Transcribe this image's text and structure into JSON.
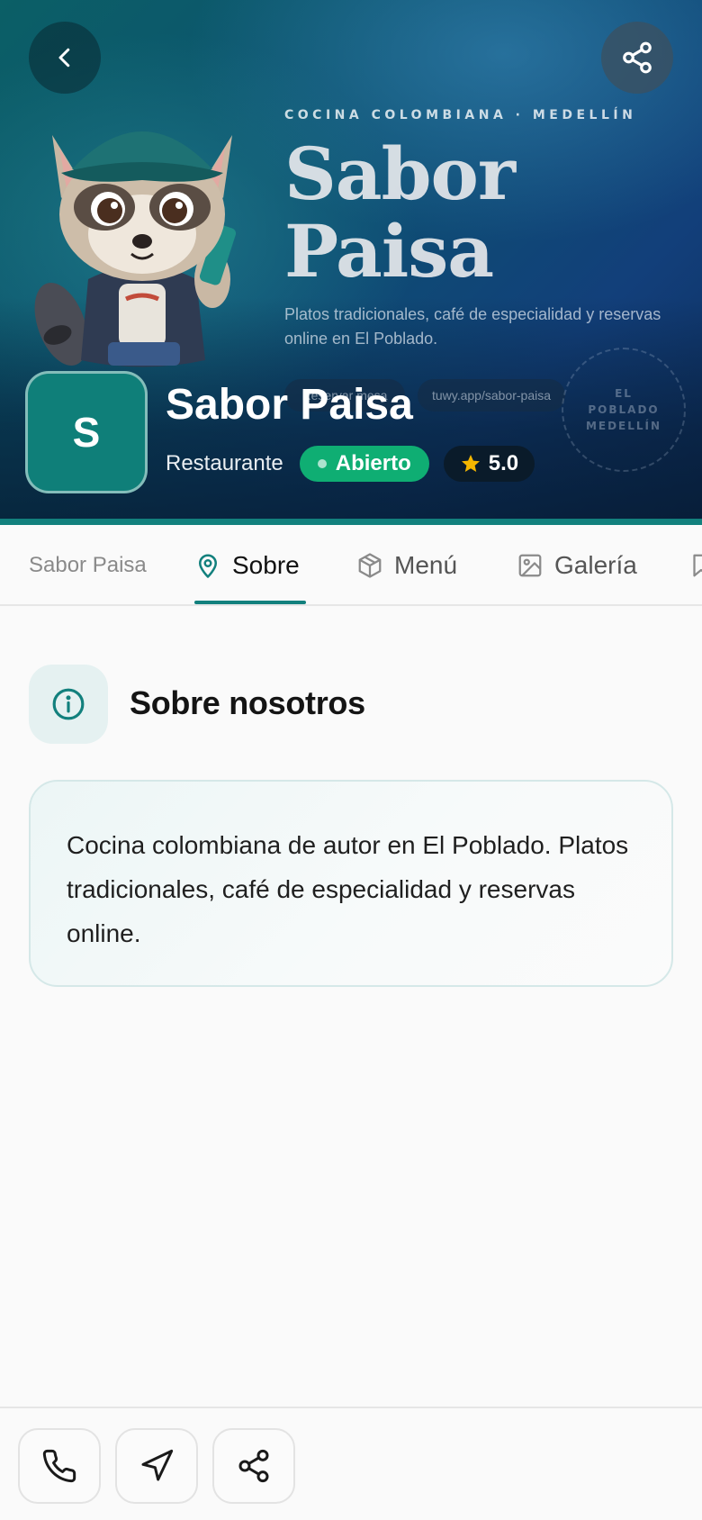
{
  "hero": {
    "kicker": "COCINA COLOMBIANA · MEDELLÍN",
    "title_line1": "Sabor",
    "title_line2": "Paisa",
    "description": "Platos tradicionales, café de especialidad y reservas online en El Poblado.",
    "ghost_pill_1": "Reservar mesa",
    "ghost_pill_2": "tuwy.app/sabor-paisa",
    "stamp_line1": "EL",
    "stamp_line2": "POBLADO",
    "stamp_line3": "MEDELLÍN"
  },
  "business": {
    "avatar_letter": "S",
    "name": "Sabor Paisa",
    "category": "Restaurante",
    "status": "Abierto",
    "rating": "5.0"
  },
  "tabs": [
    {
      "label": "Sabor Paisa",
      "icon": "none",
      "active": false
    },
    {
      "label": "Sobre",
      "icon": "map-pin-icon",
      "active": true
    },
    {
      "label": "Menú",
      "icon": "box-icon",
      "active": false
    },
    {
      "label": "Galería",
      "icon": "image-icon",
      "active": false
    },
    {
      "label": "",
      "icon": "bookmark-icon",
      "active": false
    }
  ],
  "section": {
    "icon": "info-icon",
    "title": "Sobre nosotros",
    "about_text": "Cocina colombiana de autor en El Poblado. Platos tradicionales, café de especialidad y reservas online."
  },
  "bottom_actions": [
    {
      "icon": "phone-icon"
    },
    {
      "icon": "navigation-icon"
    },
    {
      "icon": "share-icon"
    }
  ],
  "colors": {
    "accent": "#12807d",
    "open_badge": "#0fae73",
    "rating_star": "#f5b700",
    "hero_dark": "#0d4f72"
  }
}
